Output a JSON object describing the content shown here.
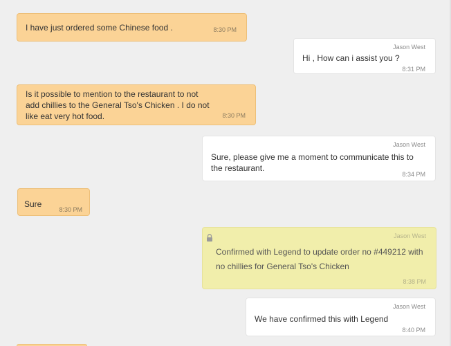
{
  "messages": [
    {
      "text": "I have just ordered some Chinese food .",
      "time": "8:30 PM"
    },
    {
      "sender": "Jason West",
      "text": "Hi , How can i assist you ?",
      "time": "8:31 PM"
    },
    {
      "text": "Is it possible to mention to the restaurant to not\nadd chillies to the General Tso's Chicken  . I do not\nlike eat very hot food.",
      "time": "8:30 PM"
    },
    {
      "sender": "Jason West",
      "text": "Sure, please give me a moment to communicate this to\nthe restaurant.",
      "time": "8:34 PM"
    },
    {
      "text": "Sure",
      "time": "8:30 PM"
    },
    {
      "sender": "Jason West",
      "text": "Confirmed with Legend to update order no #449212 with\nno chillies for General Tso's Chicken",
      "time": "8:38 PM",
      "icon": "lock-icon"
    },
    {
      "sender": "Jason West",
      "text": "We have confirmed this with Legend",
      "time": "8:40 PM"
    }
  ],
  "colors": {
    "customer_bubble": "#fbd396",
    "agent_bubble": "#ffffff",
    "internal_note_bubble": "#f1eeab",
    "background": "#efefef"
  }
}
